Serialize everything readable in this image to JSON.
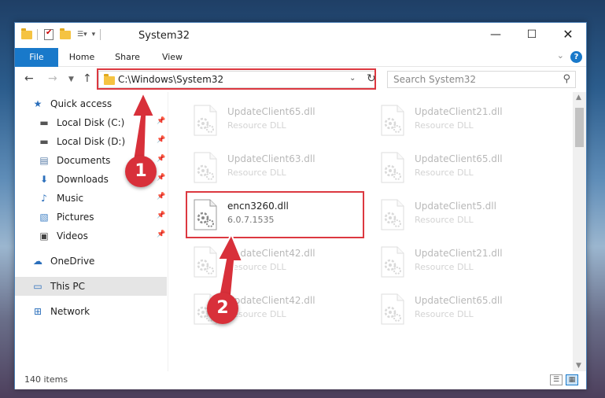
{
  "window": {
    "title": "System32",
    "controls": {
      "minimize": "—",
      "maximize": "☐",
      "close": "✕"
    }
  },
  "ribbon": {
    "tabs": [
      "File",
      "Home",
      "Share",
      "View"
    ],
    "expand": "⌄",
    "help": "?"
  },
  "nav": {
    "address": "C:\\Windows\\System32",
    "search_placeholder": "Search System32"
  },
  "sidebar": {
    "items": [
      {
        "label": "Quick access",
        "icon": "star-icon",
        "pinned": false
      },
      {
        "label": "Local Disk (C:)",
        "icon": "drive-icon",
        "pinned": true
      },
      {
        "label": "Local Disk (D:)",
        "icon": "drive-icon",
        "pinned": true
      },
      {
        "label": "Documents",
        "icon": "documents-icon",
        "pinned": true
      },
      {
        "label": "Downloads",
        "icon": "download-icon",
        "pinned": true
      },
      {
        "label": "Music",
        "icon": "music-icon",
        "pinned": true
      },
      {
        "label": "Pictures",
        "icon": "pictures-icon",
        "pinned": true
      },
      {
        "label": "Videos",
        "icon": "videos-icon",
        "pinned": true
      },
      {
        "label": "OneDrive",
        "icon": "cloud-icon",
        "pinned": false
      },
      {
        "label": "This PC",
        "icon": "computer-icon",
        "pinned": false,
        "selected": true
      },
      {
        "label": "Network",
        "icon": "network-icon",
        "pinned": false
      }
    ]
  },
  "files": [
    {
      "name": "UpdateClient65.dll",
      "sub": "Resource DLL",
      "dim": true
    },
    {
      "name": "UpdateClient21.dll",
      "sub": "Resource DLL",
      "dim": true
    },
    {
      "name": "UpdateClient63.dll",
      "sub": "Resource DLL",
      "dim": true
    },
    {
      "name": "UpdateClient65.dll",
      "sub": "Resource DLL",
      "dim": true
    },
    {
      "name": "encn3260.dll",
      "sub": "6.0.7.1535",
      "dim": false
    },
    {
      "name": "UpdateClient5.dll",
      "sub": "Resource DLL",
      "dim": true
    },
    {
      "name": "UpdateClient42.dll",
      "sub": "Resource DLL",
      "dim": true
    },
    {
      "name": "UpdateClient21.dll",
      "sub": "Resource DLL",
      "dim": true
    },
    {
      "name": "UpdateClient42.dll",
      "sub": "Resource DLL",
      "dim": true
    },
    {
      "name": "UpdateClient65.dll",
      "sub": "Resource DLL",
      "dim": true
    }
  ],
  "status": {
    "count": "140 items"
  },
  "annotations": {
    "step1": "1",
    "step2": "2",
    "color": "#d8303a"
  },
  "colors": {
    "accent": "#1979ca",
    "highlight": "#dc3840"
  }
}
